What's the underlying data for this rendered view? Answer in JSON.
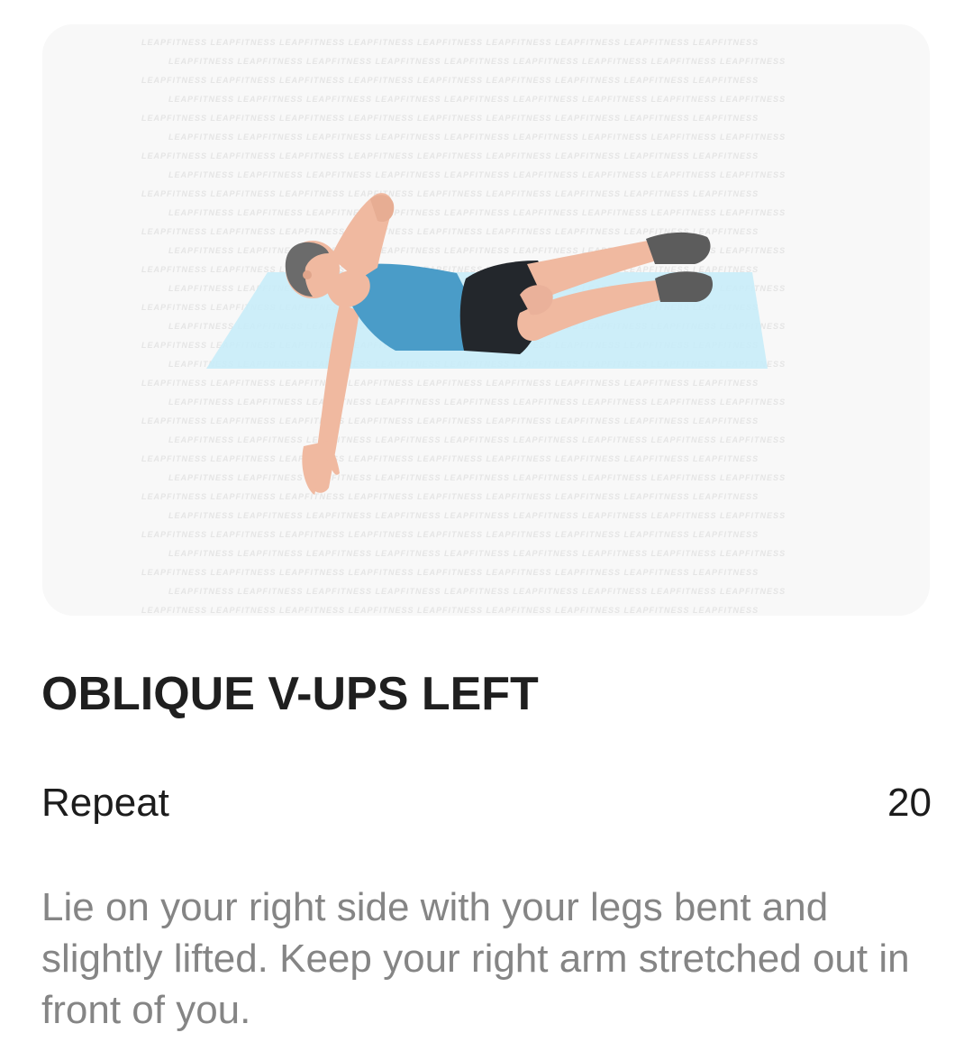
{
  "illustration": {
    "watermark_text": "LEAPFITNESS",
    "colors": {
      "card_background": "#f8f8f8",
      "mat": "#c8ecf8",
      "skin": "#f0b9a0",
      "shirt": "#4a9cc8",
      "shorts": "#23272c",
      "hair": "#6b6b6b",
      "shoes": "#5c5c5c"
    }
  },
  "exercise": {
    "title": "OBLIQUE V-UPS LEFT",
    "repeat_label": "Repeat",
    "repeat_value": "20",
    "description": "Lie on your right side with your legs bent and slightly lifted. Keep your right arm stretched out in front of you."
  }
}
